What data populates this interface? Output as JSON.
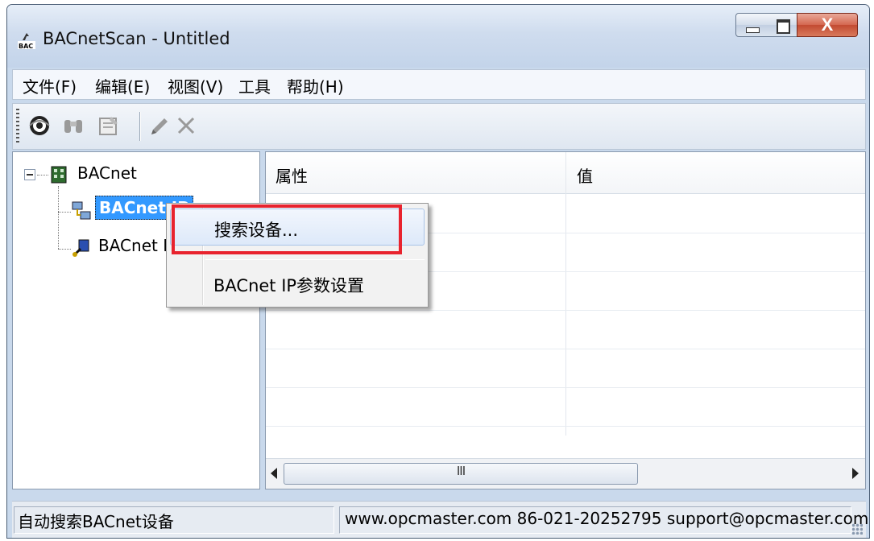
{
  "window": {
    "title": "BACnetScan - Untitled",
    "close_glyph": "X"
  },
  "menubar": {
    "items": [
      "文件(F)",
      "编辑(E)",
      "视图(V)",
      "工具",
      "帮助(H)"
    ]
  },
  "toolbar": {
    "icons": [
      "scan-eye-icon",
      "binoculars-icon",
      "properties-icon",
      "pen-icon",
      "delete-x-icon"
    ]
  },
  "tree": {
    "root": "BACnet",
    "children": [
      "BACnet IP",
      "BACnet I"
    ]
  },
  "list": {
    "columns": [
      "属性",
      "值"
    ]
  },
  "context_menu": {
    "items": [
      "搜索设备...",
      "BACnet IP参数设置"
    ],
    "highlight_color": "#e8232e"
  },
  "statusbar": {
    "left": "自动搜索BACnet设备",
    "right": "www.opcmaster.com 86-021-20252795 support@opcmaster.com"
  },
  "scrollbar": {
    "grip": "III"
  }
}
